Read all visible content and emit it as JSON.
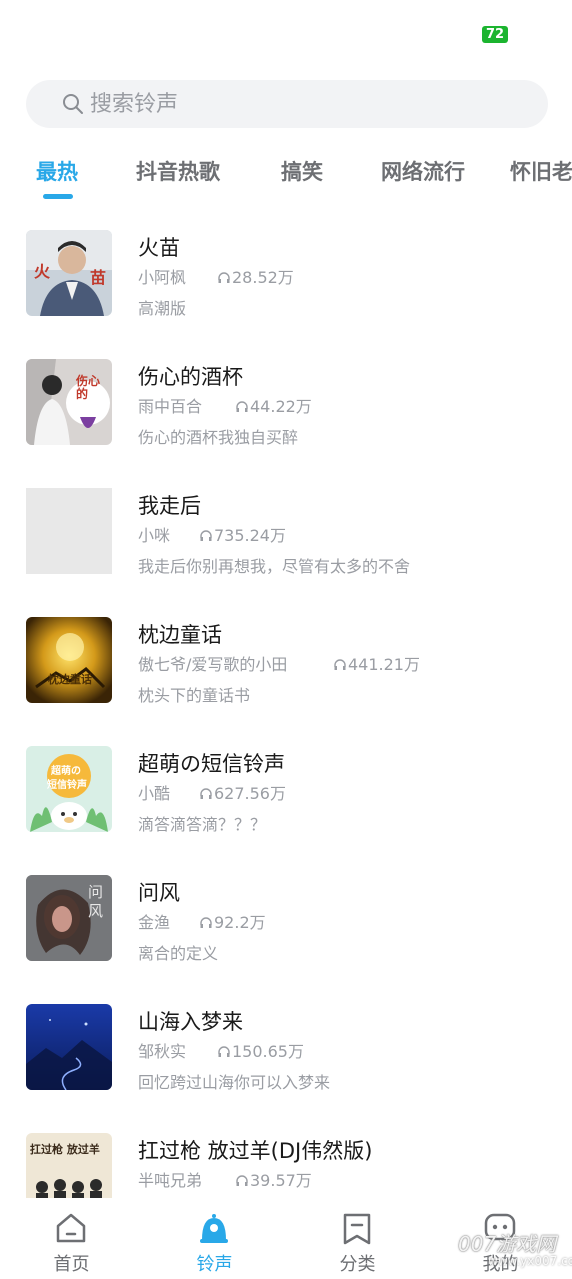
{
  "status": {
    "battery": "72"
  },
  "search": {
    "placeholder": "搜索铃声"
  },
  "tabs": [
    {
      "label": "最热"
    },
    {
      "label": "抖音热歌"
    },
    {
      "label": "搞笑"
    },
    {
      "label": "网络流行"
    },
    {
      "label": "怀旧老"
    }
  ],
  "songs": [
    {
      "title": "火苗",
      "artist": "小阿枫",
      "plays": "28.52万",
      "desc": "高潮版"
    },
    {
      "title": "伤心的酒杯",
      "artist": "雨中百合",
      "plays": "44.22万",
      "desc": "伤心的酒杯我独自买醉"
    },
    {
      "title": "我走后",
      "artist": "小咪",
      "plays": "735.24万",
      "desc": "我走后你别再想我，尽管有太多的不舍"
    },
    {
      "title": "枕边童话",
      "artist": "傲七爷/爱写歌的小田",
      "plays": "441.21万",
      "desc": "枕头下的童话书"
    },
    {
      "title": "超萌の短信铃声",
      "artist": "小酷",
      "plays": "627.56万",
      "desc": "滴答滴答滴？？？"
    },
    {
      "title": "问风",
      "artist": "金渔",
      "plays": "92.2万",
      "desc": "离合的定义"
    },
    {
      "title": "山海入梦来",
      "artist": "邹秋实",
      "plays": "150.65万",
      "desc": "回忆跨过山海你可以入梦来"
    },
    {
      "title": "扛过枪 放过羊(DJ伟然版)",
      "artist": "半吨兄弟",
      "plays": "39.57万",
      "desc": ""
    }
  ],
  "covers": {
    "c1_text_a": "火",
    "c1_text_b": "苗",
    "c2_text": "伤心的",
    "c4_text": "枕边童话",
    "c5_text_a": "超萌の",
    "c5_text_b": "短信铃声",
    "c6_text": "问风",
    "c8_text": "扛过枪 放过羊"
  },
  "nav": [
    {
      "label": "首页",
      "icon": "home-icon"
    },
    {
      "label": "铃声",
      "icon": "bell-icon"
    },
    {
      "label": "分类",
      "icon": "bookmark-icon"
    },
    {
      "label": "我的",
      "icon": "chat-icon"
    }
  ],
  "watermark": {
    "main": "007游戏网",
    "sub": "www.yx007.com"
  },
  "colors": {
    "accent": "#29a8e8",
    "text_muted": "#9a9da3",
    "search_bg": "#f2f3f5"
  }
}
